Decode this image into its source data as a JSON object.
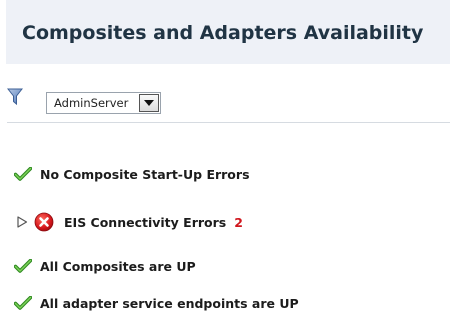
{
  "header": {
    "title": "Composites and Adapters Availability"
  },
  "toolbar": {
    "filter_icon": "filter-icon",
    "server_select": {
      "value": "AdminServer"
    }
  },
  "status_items": [
    {
      "icon": "check-icon",
      "label": "No Composite Start-Up Errors"
    },
    {
      "icon": "error-icon",
      "label": "EIS Connectivity Errors",
      "count": "2",
      "expandable": true
    },
    {
      "icon": "check-icon",
      "label": "All Composites are UP"
    },
    {
      "icon": "check-icon",
      "label": "All adapter service endpoints are UP"
    }
  ],
  "colors": {
    "header_bg": "#eef1f7",
    "title_text": "#203444",
    "check_green": "#3aa02a",
    "error_red": "#d0161d"
  }
}
